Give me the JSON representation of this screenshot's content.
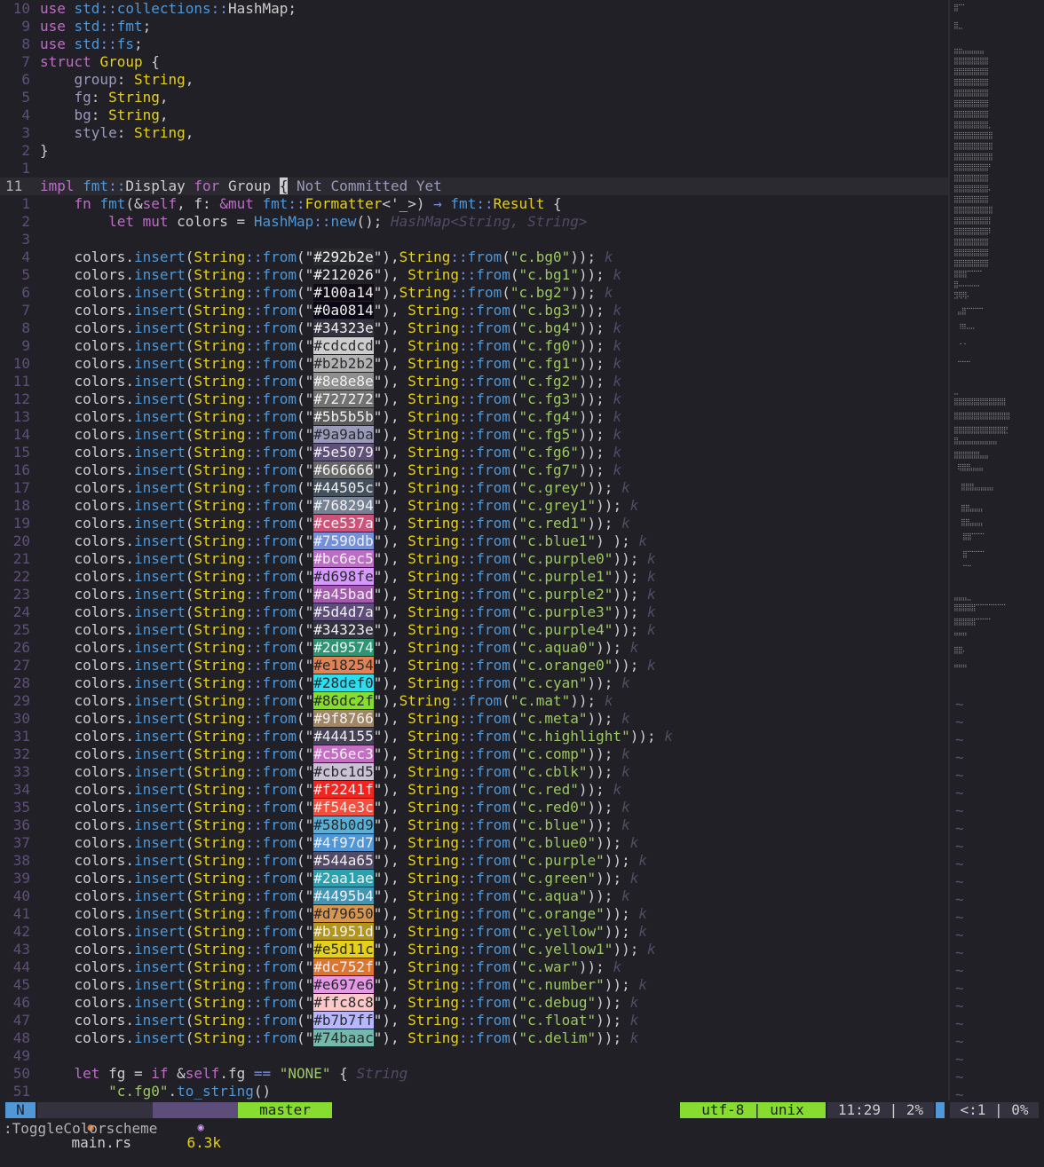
{
  "editor": {
    "blame": "Not Committed Yet",
    "hints": {
      "hashmap": "HashMap<String, String>",
      "k": "k",
      "string": "String"
    },
    "swatches": [
      {
        "hex": "#292b2e",
        "key": "c.bg0"
      },
      {
        "hex": "#212026",
        "key": "c.bg1"
      },
      {
        "hex": "#100a14",
        "key": "c.bg2"
      },
      {
        "hex": "#0a0814",
        "key": "c.bg3"
      },
      {
        "hex": "#34323e",
        "key": "c.bg4"
      },
      {
        "hex": "#cdcdcd",
        "key": "c.fg0"
      },
      {
        "hex": "#b2b2b2",
        "key": "c.fg1"
      },
      {
        "hex": "#8e8e8e",
        "key": "c.fg2"
      },
      {
        "hex": "#727272",
        "key": "c.fg3"
      },
      {
        "hex": "#5b5b5b",
        "key": "c.fg4"
      },
      {
        "hex": "#9a9aba",
        "key": "c.fg5"
      },
      {
        "hex": "#5e5079",
        "key": "c.fg6"
      },
      {
        "hex": "#666666",
        "key": "c.fg7"
      },
      {
        "hex": "#44505c",
        "key": "c.grey"
      },
      {
        "hex": "#768294",
        "key": "c.grey1"
      },
      {
        "hex": "#ce537a",
        "key": "c.red1"
      },
      {
        "hex": "#7590db",
        "key": "c.blue1"
      },
      {
        "hex": "#bc6ec5",
        "key": "c.purple0"
      },
      {
        "hex": "#d698fe",
        "key": "c.purple1"
      },
      {
        "hex": "#a45bad",
        "key": "c.purple2"
      },
      {
        "hex": "#5d4d7a",
        "key": "c.purple3"
      },
      {
        "hex": "#34323e",
        "key": "c.purple4"
      },
      {
        "hex": "#2d9574",
        "key": "c.aqua0"
      },
      {
        "hex": "#e18254",
        "key": "c.orange0"
      },
      {
        "hex": "#28def0",
        "key": "c.cyan"
      },
      {
        "hex": "#86dc2f",
        "key": "c.mat"
      },
      {
        "hex": "#9f8766",
        "key": "c.meta"
      },
      {
        "hex": "#444155",
        "key": "c.highlight"
      },
      {
        "hex": "#c56ec3",
        "key": "c.comp"
      },
      {
        "hex": "#cbc1d5",
        "key": "c.cblk"
      },
      {
        "hex": "#f2241f",
        "key": "c.red"
      },
      {
        "hex": "#f54e3c",
        "key": "c.red0"
      },
      {
        "hex": "#58b0d9",
        "key": "c.blue"
      },
      {
        "hex": "#4f97d7",
        "key": "c.blue0"
      },
      {
        "hex": "#544a65",
        "key": "c.purple"
      },
      {
        "hex": "#2aa1ae",
        "key": "c.green"
      },
      {
        "hex": "#4495b4",
        "key": "c.aqua"
      },
      {
        "hex": "#d79650",
        "key": "c.orange"
      },
      {
        "hex": "#b1951d",
        "key": "c.yellow"
      },
      {
        "hex": "#e5d11c",
        "key": "c.yellow1"
      },
      {
        "hex": "#dc752f",
        "key": "c.war"
      },
      {
        "hex": "#e697e6",
        "key": "c.number"
      },
      {
        "hex": "#ffc8c8",
        "key": "c.debug"
      },
      {
        "hex": "#b7b7ff",
        "key": "c.float"
      },
      {
        "hex": "#74baac",
        "key": "c.delim"
      }
    ]
  },
  "statusbar": {
    "mode": "N",
    "filename": "main.rs",
    "size": "6.3k",
    "branch": "master",
    "encoding": "utf-8 | unix",
    "position": "11:29 | 2%",
    "side_position": "<:1 | 0%"
  },
  "cmdline": ":ToggleColorscheme",
  "colors": {
    "mode_bg": "#4f97d7",
    "file_bg": "#34323e",
    "branch_bg": "#86dc2f",
    "accent": "#5e5079"
  }
}
